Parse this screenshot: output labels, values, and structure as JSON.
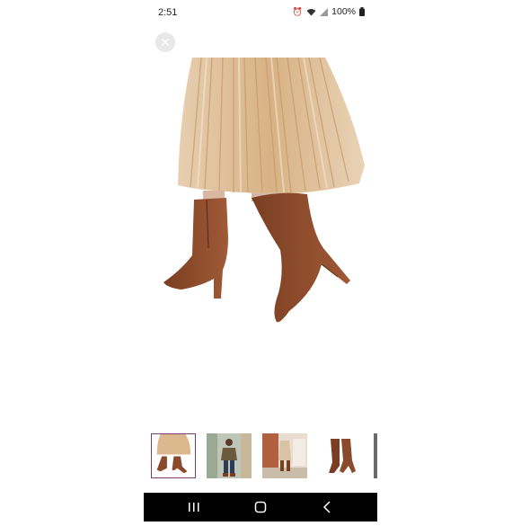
{
  "status_bar": {
    "time": "2:51",
    "icons": [
      "alarm-icon",
      "wifi-icon",
      "signal-icon",
      "battery-icon"
    ],
    "battery": "100%"
  },
  "viewer": {
    "close_icon": "close-icon",
    "thumbnails": [
      {
        "name": "pleated-skirt-boots",
        "selected": true
      },
      {
        "name": "street-style-outfit",
        "selected": false
      },
      {
        "name": "storefront-model",
        "selected": false
      },
      {
        "name": "boots-pair",
        "selected": false
      },
      {
        "name": "partial-thumbnail",
        "selected": false
      }
    ]
  },
  "nav_bar": {
    "buttons": [
      "recents-icon",
      "home-icon",
      "back-icon"
    ]
  },
  "colors": {
    "skirt": "#dcb88e",
    "boot": "#8a4a2c",
    "accent": "#7b3b6b",
    "nav_bg": "#000000"
  }
}
